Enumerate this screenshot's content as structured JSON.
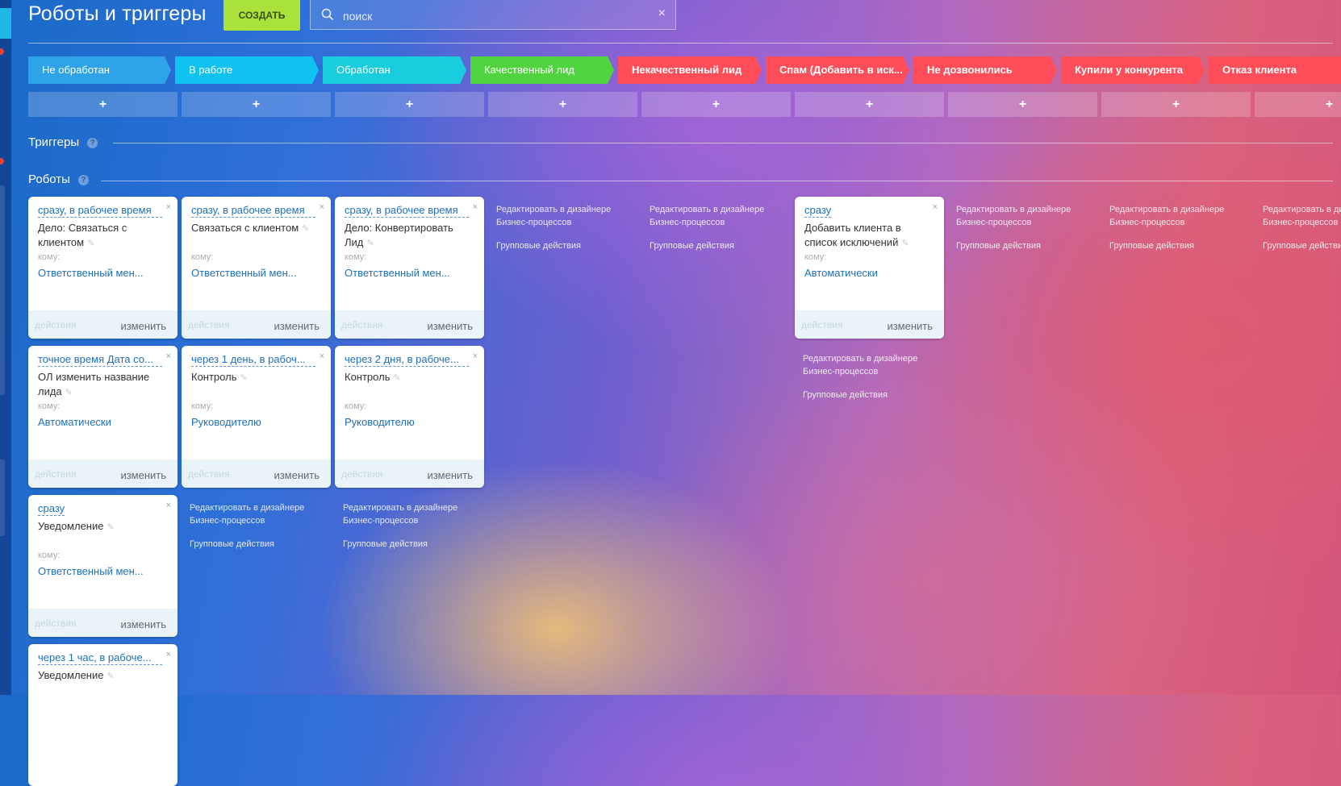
{
  "header": {
    "title": "Роботы и триггеры",
    "create_label": "СОЗДАТЬ",
    "search_placeholder": "поиск"
  },
  "stages": [
    {
      "label": "Не обработан",
      "color": "#2ea3ea",
      "bold": false
    },
    {
      "label": "В работе",
      "color": "#10c2ef",
      "bold": false
    },
    {
      "label": "Обработан",
      "color": "#18cede",
      "bold": false
    },
    {
      "label": "Качественный лид",
      "color": "#4fd43f",
      "bold": false
    },
    {
      "label": "Некачественный лид",
      "color": "#ff4d59",
      "bold": true
    },
    {
      "label": "Спам (Добавить в иск...",
      "color": "#ff4d59",
      "bold": true
    },
    {
      "label": "Не дозвонились",
      "color": "#ff4d59",
      "bold": true
    },
    {
      "label": "Купили у конкурента",
      "color": "#ff4d59",
      "bold": true
    },
    {
      "label": "Отказ клиента",
      "color": "#ff4d59",
      "bold": true
    }
  ],
  "add_label": "+",
  "sections": {
    "triggers": "Триггеры",
    "robots": "Роботы",
    "help": "?"
  },
  "card_labels": {
    "to": "кому:",
    "actions": "действия",
    "edit": "изменить",
    "close": "×",
    "pencil": "✎"
  },
  "robots": [
    {
      "when": "сразу, в рабочее время",
      "title": "Дело: Связаться с клиентом",
      "to": "Ответственный мен..."
    },
    {
      "when": "сразу, в рабочее время",
      "title": "Связаться с клиентом",
      "to": "Ответственный мен..."
    },
    {
      "when": "сразу, в рабочее время",
      "title": "Дело: Конвертировать Лид",
      "to": "Ответственный мен..."
    },
    {
      "when": "сразу",
      "title": "Добавить клиента в список исключений",
      "to": "Автоматически"
    },
    {
      "when": "точное время Дата со...",
      "title": "ОЛ изменить название лида",
      "to": "Автоматически"
    },
    {
      "when": "через 1 день, в рабоч...",
      "title": "Контроль",
      "to": "Руководителю"
    },
    {
      "when": "через 2 дня, в рабоче...",
      "title": "Контроль",
      "to": "Руководителю"
    },
    {
      "when": "сразу",
      "title": "Уведомление",
      "to": "Ответственный мен..."
    },
    {
      "when": "через 1 час, в рабоче...",
      "title": "Уведомление",
      "to": ""
    }
  ],
  "column_links": {
    "designer_1": "Редактировать в дизайнере",
    "designer_2": "Бизнес-процессов",
    "group": "Групповые действия"
  }
}
